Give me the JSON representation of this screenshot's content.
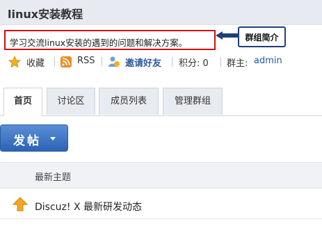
{
  "group": {
    "title": "linux安装教程",
    "description": "学习交流linux安装的遇到的问题和解决方案。",
    "annotation": "群组简介"
  },
  "meta": {
    "favorite_label": "收藏",
    "rss_label": "RSS",
    "invite_label": "邀请好友",
    "points_label": "积分: 0",
    "owner_label": "群主:",
    "owner_name": "admin"
  },
  "tabs": [
    {
      "label": "首页",
      "active": true
    },
    {
      "label": "讨论区",
      "active": false
    },
    {
      "label": "成员列表",
      "active": false
    },
    {
      "label": "管理群组",
      "active": false
    }
  ],
  "post_button": {
    "label": "发帖"
  },
  "thread_list": {
    "header": "最新主题",
    "threads": [
      {
        "title": "Discuz! X 最新研发动态",
        "icon": "pinned-up-arrow-icon"
      }
    ]
  },
  "colors": {
    "accent": "#2c63b6",
    "annotation_border": "#d01010",
    "link": "#1e5aa8"
  }
}
